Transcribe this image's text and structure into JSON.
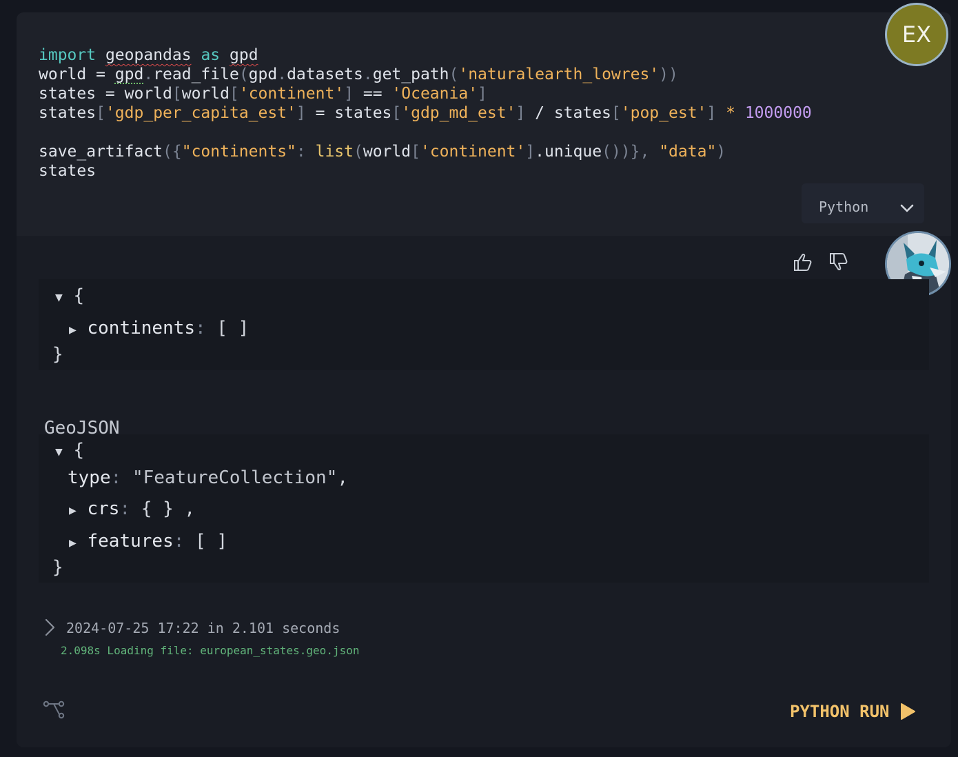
{
  "user": {
    "avatar_initials": "EX"
  },
  "code_cell": {
    "language": "Python"
  },
  "feedback": {
    "thumbs_up": "thumbs-up",
    "thumbs_down": "thumbs-down"
  },
  "artifact": {
    "root_open": "{",
    "root_close": "}",
    "key": "continents",
    "value": "[ ]"
  },
  "geojson": {
    "title": "GeoJSON",
    "root_open": "{",
    "root_close": "}",
    "type_key": "type",
    "type_value": "\"FeatureCollection\"",
    "crs_key": "crs",
    "crs_value": "{ }",
    "features_key": "features",
    "features_value": "[ ]"
  },
  "execution": {
    "summary": "2024-07-25 17:22 in 2.101 seconds",
    "log_line": "2.098s Loading file: european_states.geo.json"
  },
  "run_button": {
    "label": "PYTHON RUN"
  },
  "colors": {
    "accent": "#f2c26a",
    "keyword": "#56c8c0",
    "string": "#efb25a",
    "number": "#c39cf0",
    "log": "#61b47a"
  }
}
